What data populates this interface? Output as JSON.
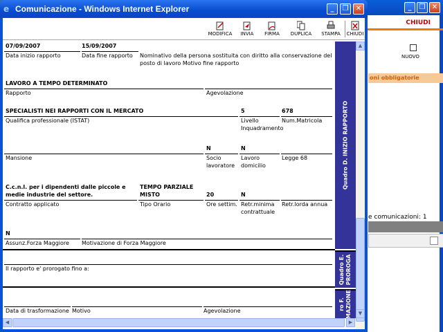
{
  "background_window": {
    "chiudi_label": "CHIUDI",
    "nuovo_label": "NUOVO",
    "obbligatorie_label": "oni obbligatorie",
    "comunicazioni_label": "e comunicazioni: 1",
    "buttons": {
      "minimize": "_",
      "restore": "❐",
      "close": "✕"
    }
  },
  "window": {
    "title": "Comunicazione - Windows Internet Explorer",
    "buttons": {
      "minimize": "_",
      "restore": "❐",
      "close": "✕"
    }
  },
  "toolbar": {
    "modifica": "MODIFICA",
    "invia": "INVIA",
    "firma": "FIRMA",
    "duplica": "DUPLICA",
    "stampa": "STAMPA",
    "chiudi": "CHIUDI"
  },
  "form": {
    "data_inizio_value": "07/09/2007",
    "data_inizio_label": "Data inizio rapporto",
    "data_fine_value": "15/09/2007",
    "data_fine_label": "Data fine rapporto",
    "nominativo_label_1": "Nominativo della persona sostituita con diritto alla conservazione del",
    "nominativo_label_2": "posto di lavoro Motivo fine rapporto",
    "rapporto_value": "LAVORO A TEMPO DETERMINATO",
    "rapporto_label": "Rapporto",
    "agevolazione_label": "Agevolazione",
    "qualifica_value": "SPECIALISTI NEI RAPPORTI CON IL MERCATO",
    "qualifica_label": "Qualifica professionale (ISTAT)",
    "livello_value": "5",
    "livello_label_1": "Livello",
    "livello_label_2": "Inquadramento",
    "matricola_value": "678",
    "matricola_label": "Num.Matricola",
    "socio_value": "N",
    "lavoro_dom_value": "N",
    "mansione_label": "Mansione",
    "socio_label_1": "Socio",
    "socio_label_2": "lavoratore",
    "lavoro_dom_label_1": "Lavoro",
    "lavoro_dom_label_2": "domicilio",
    "legge68_label": "Legge 68",
    "ccnl_value_1": "C.c.n.l. per i dipendenti dalle piccole e",
    "ccnl_value_2": "medie industrie del settore.",
    "tipo_orario_value_1": "TEMPO PARZIALE",
    "tipo_orario_value_2": "MISTO",
    "ore_value": "20",
    "retr_min_value": "N",
    "contratto_label": "Contratto applicato",
    "tipo_orario_label": "Tipo Orario",
    "ore_label": "Ore settim.",
    "retr_min_label_1": "Retr.minima",
    "retr_min_label_2": "contrattuale",
    "retr_lorda_label": "Retr.lorda annua",
    "forza_value": "N",
    "forza_label": "Assunz.Forza Maggiore",
    "motivazione_label": "Motivazione di Forza Maggiore",
    "prorogato_label": "Il rapporto e' prorogato fino a:",
    "data_trasf_label": "Data di trasformazione",
    "motivo_label": "Motivo",
    "agevolazione2_label": "Agevolazione"
  },
  "sidebands": {
    "quadro_d": "Quadro D. INIZIO RAPPORTO",
    "quadro_e_1": "Quadro E.",
    "quadro_e_2": "PROROGA",
    "quadro_f_1": "ro F.",
    "quadro_f_2": "MAZIONE"
  },
  "colors": {
    "sideband": "#333399",
    "titlebar": "#0a4cd0",
    "accent_orange": "#f07a00"
  }
}
